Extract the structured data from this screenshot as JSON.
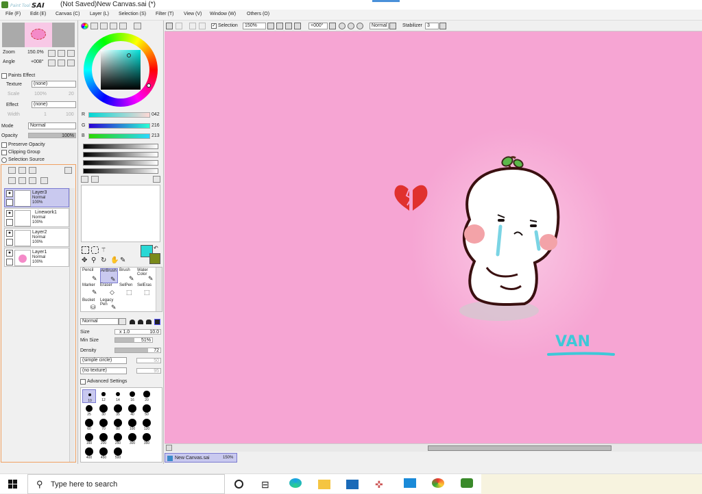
{
  "app": {
    "logo_text": "PaintTool SAI",
    "window_title": "(Not Saved)New Canvas.sai (*)"
  },
  "menu": [
    "File (F)",
    "Edit (E)",
    "Canvas (C)",
    "Layer (L)",
    "Selection (S)",
    "Filter (T)",
    "View (V)",
    "Window (W)",
    "Others (O)"
  ],
  "navigator": {
    "zoom_label": "Zoom",
    "zoom_value": "150.0%",
    "angle_label": "Angle",
    "angle_value": "+008°"
  },
  "paint_effect": {
    "header": "Paints Effect",
    "texture_label": "Texture",
    "texture_value": "(none)",
    "scale_label": "Scale",
    "scale_value": "100%",
    "scale_num": "20",
    "effect_label": "Effect",
    "effect_value": "(none)",
    "width_label": "Width",
    "width_value": "1",
    "width_num": "100"
  },
  "layer_props": {
    "mode_label": "Mode",
    "mode_value": "Normal",
    "opacity_label": "Opacity",
    "opacity_value": "100%",
    "preserve_opacity": "Preserve Opacity",
    "clipping_group": "Clipping Group",
    "selection_source": "Selection Source"
  },
  "layers": [
    {
      "name": "Layer3",
      "mode": "Normal",
      "opacity": "100%",
      "active": true
    },
    {
      "name": "Linework1",
      "mode": "Normal",
      "opacity": "100%",
      "active": false
    },
    {
      "name": "Layer2",
      "mode": "Normal",
      "opacity": "100%",
      "active": false
    },
    {
      "name": "Layer1",
      "mode": "Normal",
      "opacity": "100%",
      "active": false
    }
  ],
  "color": {
    "r_label": "R",
    "r_value": "042",
    "g_label": "G",
    "g_value": "216",
    "b_label": "B",
    "b_value": "213",
    "fg_color": "#2ad8d5",
    "bg_color": "#7a8a1a"
  },
  "tools": {
    "row1": [
      "Pencil",
      "AirBrush",
      "Brush",
      "Water Color"
    ],
    "row2": [
      "Marker",
      "Eraser",
      "SelPen",
      "SelEras"
    ],
    "row3": [
      "Bucket",
      "Legacy Pen"
    ],
    "active": "AirBrush"
  },
  "brush": {
    "blend_mode": "Normal",
    "size_label": "Size",
    "size_mult": "x 1.0",
    "size_value": "10.0",
    "min_size_label": "Min Size",
    "min_size_value": "51%",
    "density_label": "Density",
    "density_value": "72",
    "shape_value": "(simple circle)",
    "shape_num": "50",
    "texture_value": "(no texture)",
    "texture_num": "95",
    "advanced": "Advanced Settings",
    "sizes": [
      "10",
      "12",
      "14",
      "16",
      "20",
      "25",
      "30",
      "35",
      "40",
      "50",
      "60",
      "70",
      "80",
      "100",
      "120",
      "160",
      "200",
      "250",
      "300",
      "350",
      "400",
      "450",
      "500"
    ]
  },
  "toolbar": {
    "selection_label": "Selection",
    "zoom_value": "150%",
    "angle_value": "+000°",
    "mode_value": "Normal",
    "stabilizer_label": "Stabilizer",
    "stabilizer_value": "3"
  },
  "canvas": {
    "bg_color": "#f6a5d3",
    "signature": "VAN"
  },
  "tab": {
    "name": "New Canvas.sai",
    "zoom": "150%"
  },
  "taskbar": {
    "search_placeholder": "Type here to search"
  }
}
